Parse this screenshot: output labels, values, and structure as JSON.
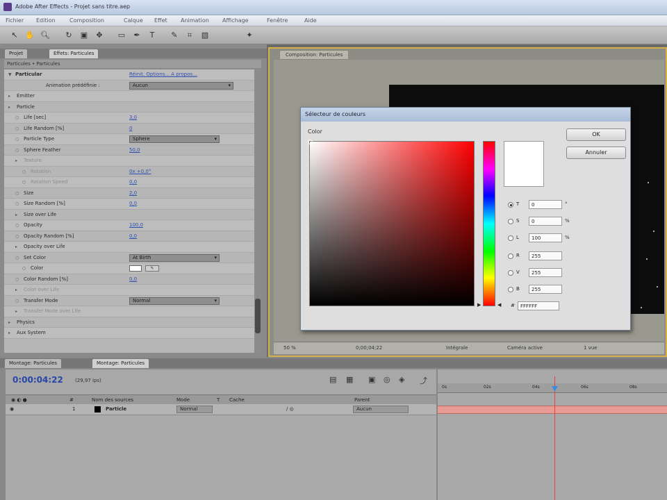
{
  "window": {
    "title": "Adobe After Effects - Projet sans titre.aep"
  },
  "menu": [
    "Fichier",
    "Edition",
    "Composition",
    "Calque",
    "Effet",
    "Animation",
    "Affichage",
    "Fenêtre",
    "Aide"
  ],
  "tools": [
    "selection-tool",
    "hand-tool",
    "zoom-tool",
    "rotate-tool",
    "camera-tool",
    "pan-tool",
    "mask-tool",
    "pen-tool",
    "text-tool",
    "brush-tool",
    "clone-tool",
    "eraser-tool",
    "puppet-tool"
  ],
  "left_panel": {
    "tabs": [
      "Projet",
      "Effets: Particules"
    ],
    "header": "Particules • Particules",
    "effect_name": "Particular",
    "effect_links": "Réinit.  Options...  A propos...",
    "preset_label": "Animation prédéfinie :",
    "preset_value": "Aucun",
    "properties": [
      {
        "label": "Emitter",
        "indent": 1,
        "type": "group"
      },
      {
        "label": "Particle",
        "indent": 1,
        "type": "group"
      },
      {
        "label": "Life [sec]",
        "indent": 2,
        "type": "value",
        "value": "3,0"
      },
      {
        "label": "Life Random [%]",
        "indent": 2,
        "type": "value",
        "value": "0"
      },
      {
        "label": "Particle Type",
        "indent": 2,
        "type": "dropdown",
        "value": "Sphere"
      },
      {
        "label": "Sphere Feather",
        "indent": 2,
        "type": "value",
        "value": "50,0"
      },
      {
        "label": "Texture",
        "indent": 2,
        "type": "group",
        "dim": true
      },
      {
        "label": "Rotation",
        "indent": 3,
        "type": "value",
        "value": "0x +0,0°",
        "dim": true
      },
      {
        "label": "Rotation Speed",
        "indent": 3,
        "type": "value",
        "value": "0,0",
        "dim": true
      },
      {
        "label": "Size",
        "indent": 2,
        "type": "value",
        "value": "2,0"
      },
      {
        "label": "Size Random [%]",
        "indent": 2,
        "type": "value",
        "value": "0,0"
      },
      {
        "label": "Size over Life",
        "indent": 2,
        "type": "group"
      },
      {
        "label": "Opacity",
        "indent": 2,
        "type": "value",
        "value": "100,0"
      },
      {
        "label": "Opacity Random [%]",
        "indent": 2,
        "type": "value",
        "value": "0,0"
      },
      {
        "label": "Opacity over Life",
        "indent": 2,
        "type": "group"
      },
      {
        "label": "Set Color",
        "indent": 2,
        "type": "dropdown",
        "value": "At Birth"
      },
      {
        "label": "Color",
        "indent": 3,
        "type": "color"
      },
      {
        "label": "Color Random [%]",
        "indent": 2,
        "type": "value",
        "value": "0,0"
      },
      {
        "label": "Color over Life",
        "indent": 2,
        "type": "group",
        "dim": true
      },
      {
        "label": "Transfer Mode",
        "indent": 2,
        "type": "dropdown",
        "value": "Normal"
      },
      {
        "label": "Transfer Mode over Life",
        "indent": 2,
        "type": "group",
        "dim": true
      },
      {
        "label": "Physics",
        "indent": 1,
        "type": "group"
      },
      {
        "label": "Aux System",
        "indent": 1,
        "type": "group"
      }
    ]
  },
  "comp_panel": {
    "tab": "Composition: Particules",
    "zoom": "50 %",
    "timecode": "0;00;04;22",
    "quality": "Intégrale",
    "camera": "Caméra active",
    "views": "1 vue"
  },
  "color_picker": {
    "title": "Sélecteur de couleurs",
    "color_label": "Color",
    "ok_label": "OK",
    "cancel_label": "Annuler",
    "fields": [
      {
        "key": "T",
        "value": "0",
        "unit": "°",
        "checked": true
      },
      {
        "key": "S",
        "value": "0",
        "unit": "%",
        "checked": false
      },
      {
        "key": "L",
        "value": "100",
        "unit": "%",
        "checked": false
      },
      {
        "key": "R",
        "value": "255",
        "unit": "",
        "checked": false
      },
      {
        "key": "V",
        "value": "255",
        "unit": "",
        "checked": false
      },
      {
        "key": "B",
        "value": "255",
        "unit": "",
        "checked": false
      }
    ],
    "hex_label": "#",
    "hex_value": "FFFFFF",
    "selected_color": "#ffffff",
    "hue_color": "#ff0000"
  },
  "timeline": {
    "tabs": [
      "Montage: Particules",
      "Montage: Particules"
    ],
    "timecode": "0:00:04:22",
    "fps": "(29,97 ips)",
    "columns": [
      "#",
      "Nom des sources",
      "Mode",
      "T",
      "Cache",
      "Parent"
    ],
    "layer": {
      "index": "1",
      "name": "Particle",
      "mode": "Normal",
      "parent": "Aucun"
    },
    "ruler": [
      "0s",
      "02s",
      "04s",
      "06s",
      "08s"
    ],
    "layer_bar_color": "#e79b94",
    "playhead_color": "#d9473b"
  }
}
